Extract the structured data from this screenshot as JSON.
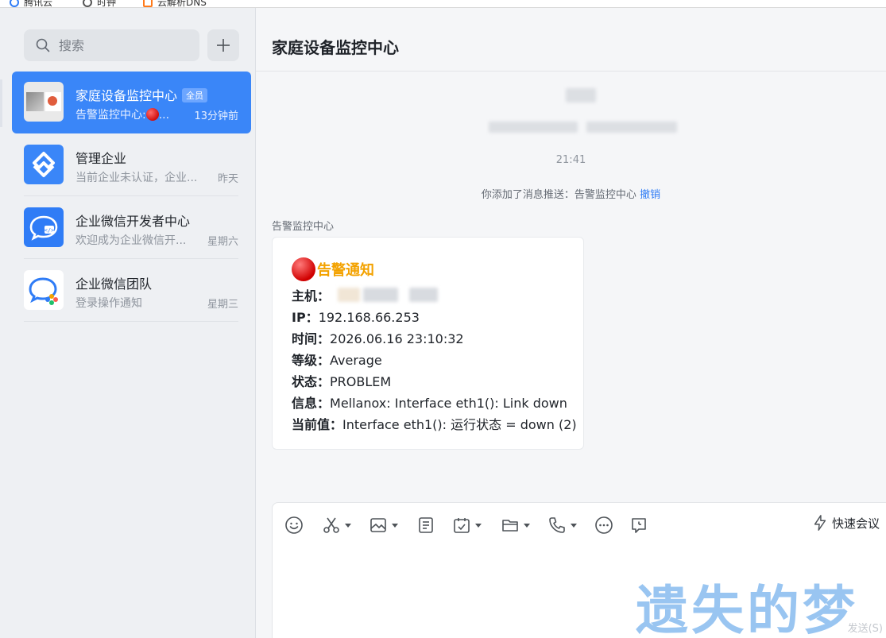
{
  "bookmarks": [
    {
      "label": "腾讯云"
    },
    {
      "label": "时钟"
    },
    {
      "label": "云解析DNS"
    }
  ],
  "sidebar": {
    "search_placeholder": "搜索",
    "chats": [
      {
        "name": "家庭设备监控中心",
        "badge": "全员",
        "preview_prefix": "告警监控中心:",
        "preview_suffix": "...",
        "time": "13分钟前",
        "active": true
      },
      {
        "name": "管理企业",
        "preview": "当前企业未认证，企业...",
        "time": "昨天"
      },
      {
        "name": "企业微信开发者中心",
        "preview": "欢迎成为企业微信开...",
        "time": "星期六"
      },
      {
        "name": "企业微信团队",
        "preview": "登录操作通知",
        "time": "星期三"
      }
    ]
  },
  "main": {
    "title": "家庭设备监控中心",
    "system_time": "21:41",
    "system_note": "你添加了消息推送：告警监控中心",
    "undo": "撤销",
    "sender": "告警监控中心",
    "alert": {
      "title": "告警通知",
      "host_label": "主机：",
      "ip_label": "IP：",
      "ip": "192.168.66.253",
      "time_label": "时间：",
      "time": "2026.06.16 23:10:32",
      "level_label": "等级：",
      "level": "Average",
      "status_label": "状态：",
      "status": "PROBLEM",
      "info_label": "信息：",
      "info": "Mellanox: Interface eth1(): Link down",
      "value_label": "当前值：",
      "value": "Interface eth1(): 运行状态 = down (2)"
    }
  },
  "composer": {
    "quick_meeting": "快速会议",
    "send_hint": "发送(S)"
  },
  "watermark": "遗失的梦",
  "colors": {
    "accent": "#3a86f8",
    "alert_title": "#f3a200",
    "link": "#2f7cf6"
  }
}
